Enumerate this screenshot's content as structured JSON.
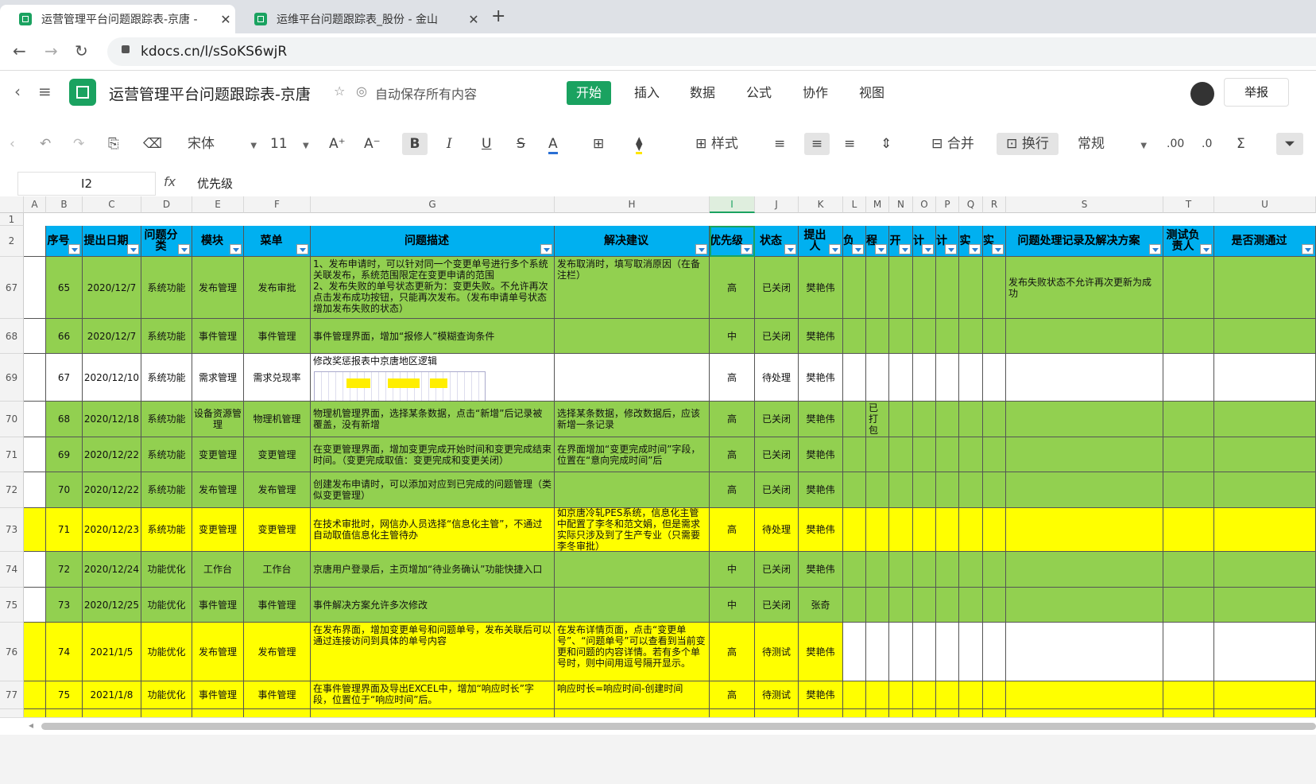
{
  "browser": {
    "tabs": [
      {
        "title": "运营管理平台问题跟踪表-京唐 -",
        "active": true
      },
      {
        "title": "运维平台问题跟踪表_股份 - 金山",
        "active": false
      }
    ],
    "url": "kdocs.cn/l/sSoKS6wjR"
  },
  "app": {
    "doc_title": "运营管理平台问题跟踪表-京唐",
    "autosave": "自动保存所有内容",
    "menus": [
      "开始",
      "插入",
      "数据",
      "公式",
      "协作",
      "视图"
    ],
    "report_label": "举报"
  },
  "toolbar": {
    "font": "宋体",
    "size": "11",
    "bold": "B",
    "italic": "I",
    "underline": "U",
    "strike": "S",
    "style": "样式",
    "merge": "合并",
    "wrap": "换行",
    "format": "常规"
  },
  "formula_bar": {
    "cell_ref": "I2",
    "fx": "fx",
    "value": "优先级"
  },
  "columns": [
    "A",
    "B",
    "C",
    "D",
    "E",
    "F",
    "G",
    "H",
    "I",
    "J",
    "K",
    "L",
    "M",
    "N",
    "O",
    "P",
    "Q",
    "R",
    "S",
    "T",
    "U"
  ],
  "header_row": {
    "row_no": "1",
    "row2_no": "2",
    "labels": [
      "",
      "序号",
      "提出日期",
      "问题分类",
      "模块",
      "菜单",
      "问题描述",
      "解决建议",
      "优先级",
      "状态",
      "提出人",
      "负",
      "程",
      "开",
      "计",
      "计",
      "实",
      "实",
      "问题处理记录及解决方案",
      "测试负责人",
      "是否测通过"
    ]
  },
  "rows": [
    {
      "no": "67",
      "fill": "g",
      "cells": [
        "",
        "65",
        "2020/12/7",
        "系统功能",
        "发布管理",
        "发布审批",
        "1、发布申请时，可以针对同一个变更单号进行多个系统关联发布，系统范围限定在变更申请的范围\n2、发布失败的单号状态更新为：变更失败。不允许再次点击发布成功按钮，只能再次发布。（发布申请单号状态增加发布失败的状态）",
        "发布取消时，填写取消原因（在备注栏）",
        "高",
        "已关闭",
        "樊艳伟",
        "",
        "",
        "",
        "",
        "",
        "",
        "",
        "发布失败状态不允许再次更新为成功",
        "",
        ""
      ]
    },
    {
      "no": "68",
      "fill": "g",
      "cells": [
        "",
        "66",
        "2020/12/7",
        "系统功能",
        "事件管理",
        "事件管理",
        "事件管理界面，增加“报修人”模糊查询条件",
        "",
        "中",
        "已关闭",
        "樊艳伟",
        "",
        "",
        "",
        "",
        "",
        "",
        "",
        "",
        "",
        ""
      ]
    },
    {
      "no": "69",
      "fill": "w",
      "cells": [
        "",
        "67",
        "2020/12/10",
        "系统功能",
        "需求管理",
        "需求兑现率",
        "修改奖惩报表中京唐地区逻辑",
        "",
        "高",
        "待处理",
        "樊艳伟",
        "",
        "",
        "",
        "",
        "",
        "",
        "",
        "",
        "",
        ""
      ]
    },
    {
      "no": "70",
      "fill": "g",
      "cells": [
        "",
        "68",
        "2020/12/18",
        "系统功能",
        "设备资源管理",
        "物理机管理",
        "物理机管理界面，选择某条数据，点击“新增”后记录被覆盖，没有新增",
        "选择某条数据，修改数据后，应该新增一条记录",
        "高",
        "已关闭",
        "樊艳伟",
        "",
        "已打包",
        "",
        "",
        "",
        "",
        "",
        "",
        "",
        ""
      ]
    },
    {
      "no": "71",
      "fill": "g",
      "cells": [
        "",
        "69",
        "2020/12/22",
        "系统功能",
        "变更管理",
        "变更管理",
        "在变更管理界面，增加变更完成开始时间和变更完成结束时间。（变更完成取值：变更完成和变更关闭）",
        "在界面增加“变更完成时间”字段，位置在“意向完成时间”后",
        "高",
        "已关闭",
        "樊艳伟",
        "",
        "",
        "",
        "",
        "",
        "",
        "",
        "",
        "",
        ""
      ]
    },
    {
      "no": "72",
      "fill": "g",
      "cells": [
        "",
        "70",
        "2020/12/22",
        "系统功能",
        "发布管理",
        "发布管理",
        "创建发布申请时，可以添加对应到已完成的问题管理（类似变更管理）",
        "",
        "高",
        "已关闭",
        "樊艳伟",
        "",
        "",
        "",
        "",
        "",
        "",
        "",
        "",
        "",
        ""
      ]
    },
    {
      "no": "73",
      "fill": "y",
      "cells": [
        "",
        "71",
        "2020/12/23",
        "系统功能",
        "变更管理",
        "变更管理",
        "在技术审批时，网信办人员选择“信息化主管”，不通过自动取值信息化主管待办",
        "如京唐冷轧PES系统，信息化主管中配置了李冬和范文娟，但是需求实际只涉及到了生产专业（只需要李冬审批）",
        "高",
        "待处理",
        "樊艳伟",
        "",
        "",
        "",
        "",
        "",
        "",
        "",
        "",
        "",
        ""
      ]
    },
    {
      "no": "74",
      "fill": "g",
      "cells": [
        "",
        "72",
        "2020/12/24",
        "功能优化",
        "工作台",
        "工作台",
        "京唐用户登录后，主页增加“待业务确认”功能快捷入口",
        "",
        "中",
        "已关闭",
        "樊艳伟",
        "",
        "",
        "",
        "",
        "",
        "",
        "",
        "",
        "",
        ""
      ]
    },
    {
      "no": "75",
      "fill": "g",
      "cells": [
        "",
        "73",
        "2020/12/25",
        "功能优化",
        "事件管理",
        "事件管理",
        "事件解决方案允许多次修改",
        "",
        "中",
        "已关闭",
        "张奇",
        "",
        "",
        "",
        "",
        "",
        "",
        "",
        "",
        "",
        ""
      ]
    },
    {
      "no": "76",
      "fill": "y",
      "cells": [
        "",
        "74",
        "2021/1/5",
        "功能优化",
        "发布管理",
        "发布管理",
        "在发布界面，增加变更单号和问题单号，发布关联后可以通过连接访问到具体的单号内容",
        "在发布详情页面，点击“变更单号”、“问题单号”可以查看到当前变更和问题的内容详情。若有多个单号时，则中间用逗号隔开显示。",
        "高",
        "待测试",
        "樊艳伟",
        "",
        "",
        "",
        "",
        "",
        "",
        "",
        "",
        "",
        ""
      ]
    },
    {
      "no": "77",
      "fill": "y",
      "cells": [
        "",
        "75",
        "2021/1/8",
        "功能优化",
        "事件管理",
        "事件管理",
        "在事件管理界面及导出EXCEL中，增加“响应时长”字段，位置位于“响应时间”后。",
        "响应时长=响应时间-创建时间",
        "高",
        "待测试",
        "樊艳伟",
        "",
        "",
        "",
        "",
        "",
        "",
        "",
        "",
        "",
        ""
      ]
    },
    {
      "no": "",
      "fill": "y",
      "cells": [
        "",
        "",
        "",
        "",
        "",
        "",
        "",
        "",
        "",
        "",
        "",
        "",
        "",
        "",
        "",
        "",
        "",
        "",
        "",
        "",
        ""
      ]
    }
  ]
}
